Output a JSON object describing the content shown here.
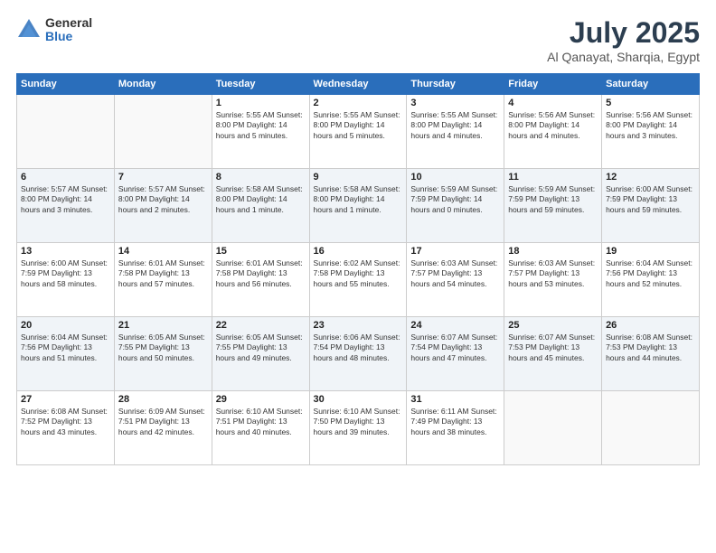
{
  "logo": {
    "general": "General",
    "blue": "Blue"
  },
  "title": {
    "month": "July 2025",
    "location": "Al Qanayat, Sharqia, Egypt"
  },
  "days_of_week": [
    "Sunday",
    "Monday",
    "Tuesday",
    "Wednesday",
    "Thursday",
    "Friday",
    "Saturday"
  ],
  "weeks": [
    [
      {
        "day": "",
        "info": ""
      },
      {
        "day": "",
        "info": ""
      },
      {
        "day": "1",
        "info": "Sunrise: 5:55 AM\nSunset: 8:00 PM\nDaylight: 14 hours\nand 5 minutes."
      },
      {
        "day": "2",
        "info": "Sunrise: 5:55 AM\nSunset: 8:00 PM\nDaylight: 14 hours\nand 5 minutes."
      },
      {
        "day": "3",
        "info": "Sunrise: 5:55 AM\nSunset: 8:00 PM\nDaylight: 14 hours\nand 4 minutes."
      },
      {
        "day": "4",
        "info": "Sunrise: 5:56 AM\nSunset: 8:00 PM\nDaylight: 14 hours\nand 4 minutes."
      },
      {
        "day": "5",
        "info": "Sunrise: 5:56 AM\nSunset: 8:00 PM\nDaylight: 14 hours\nand 3 minutes."
      }
    ],
    [
      {
        "day": "6",
        "info": "Sunrise: 5:57 AM\nSunset: 8:00 PM\nDaylight: 14 hours\nand 3 minutes."
      },
      {
        "day": "7",
        "info": "Sunrise: 5:57 AM\nSunset: 8:00 PM\nDaylight: 14 hours\nand 2 minutes."
      },
      {
        "day": "8",
        "info": "Sunrise: 5:58 AM\nSunset: 8:00 PM\nDaylight: 14 hours\nand 1 minute."
      },
      {
        "day": "9",
        "info": "Sunrise: 5:58 AM\nSunset: 8:00 PM\nDaylight: 14 hours\nand 1 minute."
      },
      {
        "day": "10",
        "info": "Sunrise: 5:59 AM\nSunset: 7:59 PM\nDaylight: 14 hours\nand 0 minutes."
      },
      {
        "day": "11",
        "info": "Sunrise: 5:59 AM\nSunset: 7:59 PM\nDaylight: 13 hours\nand 59 minutes."
      },
      {
        "day": "12",
        "info": "Sunrise: 6:00 AM\nSunset: 7:59 PM\nDaylight: 13 hours\nand 59 minutes."
      }
    ],
    [
      {
        "day": "13",
        "info": "Sunrise: 6:00 AM\nSunset: 7:59 PM\nDaylight: 13 hours\nand 58 minutes."
      },
      {
        "day": "14",
        "info": "Sunrise: 6:01 AM\nSunset: 7:58 PM\nDaylight: 13 hours\nand 57 minutes."
      },
      {
        "day": "15",
        "info": "Sunrise: 6:01 AM\nSunset: 7:58 PM\nDaylight: 13 hours\nand 56 minutes."
      },
      {
        "day": "16",
        "info": "Sunrise: 6:02 AM\nSunset: 7:58 PM\nDaylight: 13 hours\nand 55 minutes."
      },
      {
        "day": "17",
        "info": "Sunrise: 6:03 AM\nSunset: 7:57 PM\nDaylight: 13 hours\nand 54 minutes."
      },
      {
        "day": "18",
        "info": "Sunrise: 6:03 AM\nSunset: 7:57 PM\nDaylight: 13 hours\nand 53 minutes."
      },
      {
        "day": "19",
        "info": "Sunrise: 6:04 AM\nSunset: 7:56 PM\nDaylight: 13 hours\nand 52 minutes."
      }
    ],
    [
      {
        "day": "20",
        "info": "Sunrise: 6:04 AM\nSunset: 7:56 PM\nDaylight: 13 hours\nand 51 minutes."
      },
      {
        "day": "21",
        "info": "Sunrise: 6:05 AM\nSunset: 7:55 PM\nDaylight: 13 hours\nand 50 minutes."
      },
      {
        "day": "22",
        "info": "Sunrise: 6:05 AM\nSunset: 7:55 PM\nDaylight: 13 hours\nand 49 minutes."
      },
      {
        "day": "23",
        "info": "Sunrise: 6:06 AM\nSunset: 7:54 PM\nDaylight: 13 hours\nand 48 minutes."
      },
      {
        "day": "24",
        "info": "Sunrise: 6:07 AM\nSunset: 7:54 PM\nDaylight: 13 hours\nand 47 minutes."
      },
      {
        "day": "25",
        "info": "Sunrise: 6:07 AM\nSunset: 7:53 PM\nDaylight: 13 hours\nand 45 minutes."
      },
      {
        "day": "26",
        "info": "Sunrise: 6:08 AM\nSunset: 7:53 PM\nDaylight: 13 hours\nand 44 minutes."
      }
    ],
    [
      {
        "day": "27",
        "info": "Sunrise: 6:08 AM\nSunset: 7:52 PM\nDaylight: 13 hours\nand 43 minutes."
      },
      {
        "day": "28",
        "info": "Sunrise: 6:09 AM\nSunset: 7:51 PM\nDaylight: 13 hours\nand 42 minutes."
      },
      {
        "day": "29",
        "info": "Sunrise: 6:10 AM\nSunset: 7:51 PM\nDaylight: 13 hours\nand 40 minutes."
      },
      {
        "day": "30",
        "info": "Sunrise: 6:10 AM\nSunset: 7:50 PM\nDaylight: 13 hours\nand 39 minutes."
      },
      {
        "day": "31",
        "info": "Sunrise: 6:11 AM\nSunset: 7:49 PM\nDaylight: 13 hours\nand 38 minutes."
      },
      {
        "day": "",
        "info": ""
      },
      {
        "day": "",
        "info": ""
      }
    ]
  ]
}
